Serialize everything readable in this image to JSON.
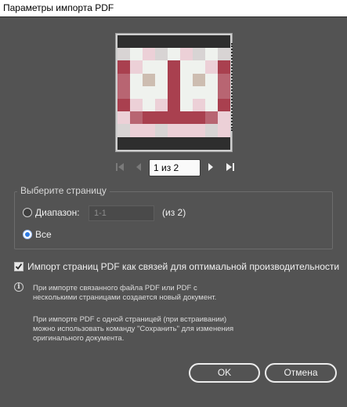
{
  "window": {
    "title": "Параметры импорта PDF"
  },
  "preview": {
    "palette": {
      "d": "#2e2e2e",
      "g": "#d8d4d4",
      "w": "#eff2ee",
      "p": "#ecd0d7",
      "r": "#a9404f",
      "m": "#b86572",
      "t": "#cdbdb1"
    }
  },
  "pager": {
    "value": "1 из 2",
    "first_icon": "skip-to-first-icon",
    "prev_icon": "previous-page-icon",
    "next_icon": "next-page-icon",
    "last_icon": "skip-to-last-icon"
  },
  "page_select": {
    "legend": "Выберите страницу",
    "range_label": "Диапазон:",
    "range_value": "1-1",
    "range_total": "(из 2)",
    "all_label": "Все",
    "selected": "all"
  },
  "link_option": {
    "label": "Импорт страниц PDF как связей для оптимальной производительности",
    "checked": true
  },
  "info": {
    "icon": "info-icon",
    "note1_line1": "При импорте связанного файла PDF или PDF с",
    "note1_line2": "несколькими страницами создается новый документ.",
    "note2_line1": "При импорте PDF с одной страницей (при встраивании)",
    "note2_line2": "можно использовать команду \"Сохранить\" для изменения",
    "note2_line3": "оригинального документа."
  },
  "buttons": {
    "ok": "OK",
    "cancel": "Отмена"
  },
  "colors": {
    "dialog_bg": "#535353",
    "accent": "#2d7be6"
  }
}
